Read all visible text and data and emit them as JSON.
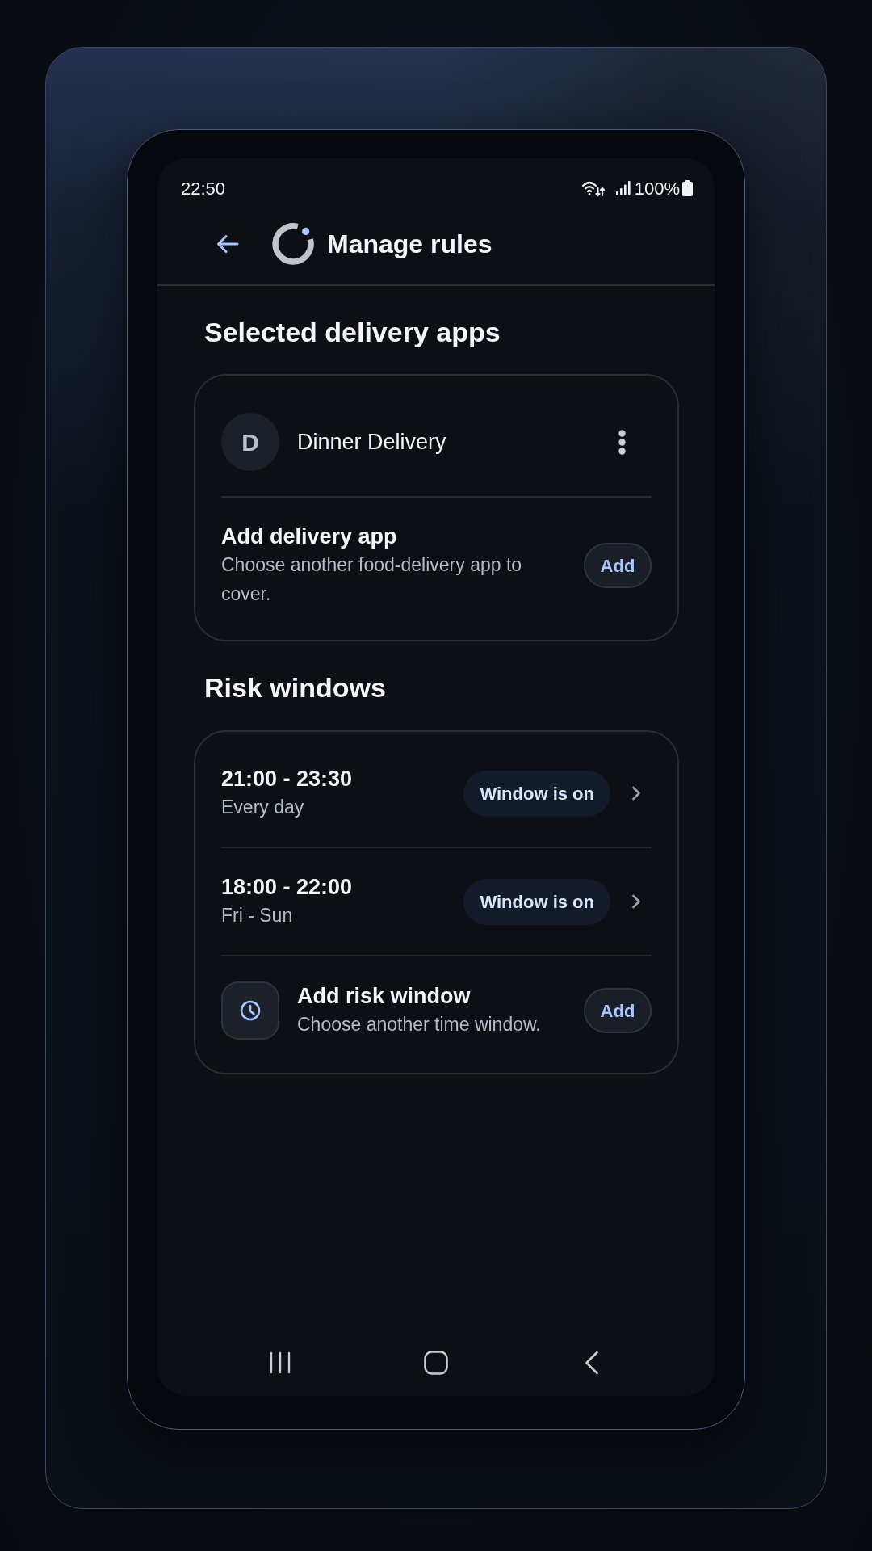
{
  "status_bar": {
    "time": "22:50",
    "battery": "100%"
  },
  "header": {
    "title": "Manage rules"
  },
  "sections": [
    {
      "kind": "apps",
      "title": "Selected delivery apps",
      "items": [
        {
          "initial": "D",
          "name": "Dinner Delivery"
        }
      ],
      "add": {
        "title": "Add delivery app",
        "subtitle": "Choose another food-delivery app to cover.",
        "button": "Add"
      }
    },
    {
      "kind": "windows",
      "title": "Risk windows",
      "items": [
        {
          "time": "21:00 - 23:30",
          "days": "Every day",
          "status": "Window is on"
        },
        {
          "time": "18:00 - 22:00",
          "days": "Fri - Sun",
          "status": "Window is on"
        }
      ],
      "add": {
        "title": "Add risk window",
        "subtitle": "Choose another time window.",
        "button": "Add"
      }
    }
  ]
}
